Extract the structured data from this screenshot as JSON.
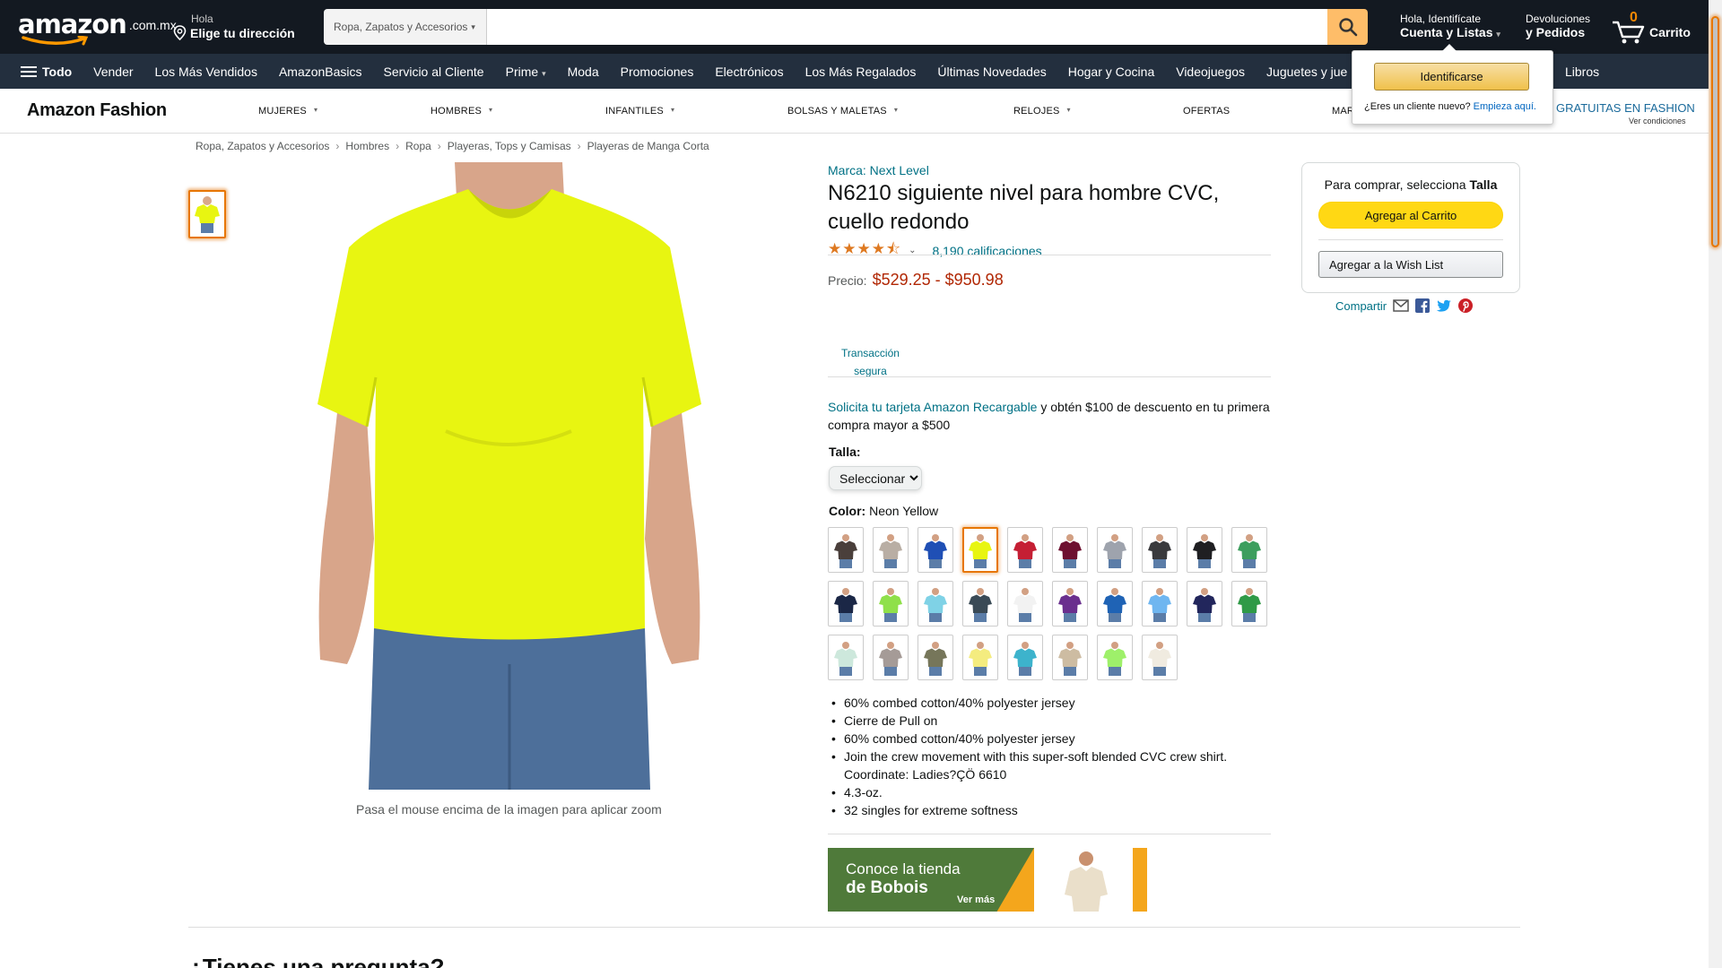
{
  "nav": {
    "logo_word": "amazon",
    "logo_tld": ".com.mx",
    "address_hello": "Hola",
    "address_cta": "Elige tu dirección",
    "search_category": "Ropa, Zapatos y Accesorios",
    "search_value": "",
    "account_line1": "Hola, Identifícate",
    "account_line2": "Cuenta y Listas",
    "returns_line1": "Devoluciones",
    "returns_line2": "y Pedidos",
    "cart_count": "0",
    "cart_label": "Carrito"
  },
  "subnav": {
    "all_label": "Todo",
    "items": [
      "Vender",
      "Los Más Vendidos",
      "AmazonBasics",
      "Servicio al Cliente",
      "Prime",
      "Moda",
      "Promociones",
      "Electrónicos",
      "Los Más Regalados",
      "Últimas Novedades",
      "Hogar y Cocina",
      "Videojuegos",
      "Juguetes y jue",
      "Libros"
    ]
  },
  "fashion": {
    "brand": "Amazon Fashion",
    "items": [
      "MUJERES",
      "HOMBRES",
      "INFANTILES",
      "BOLSAS Y MALETAS",
      "RELOJES",
      "OFERTAS",
      "MAR"
    ],
    "promo": "GRATUITAS EN FASHION",
    "promo_sub": "Ver condiciones"
  },
  "flyout": {
    "signin_label": "Identificarse",
    "new_customer": "¿Eres un cliente nuevo?",
    "start_here": "Empieza aquí."
  },
  "breadcrumb": [
    "Ropa, Zapatos y Accesorios",
    "Hombres",
    "Ropa",
    "Playeras, Tops y Camisas",
    "Playeras de Manga Corta"
  ],
  "product": {
    "brand_link": "Marca: Next Level",
    "title": "N6210 siguiente nivel para hombre CVC, cuello redondo",
    "rating_stars": 4.5,
    "rating_count": "8,190 calificaciones",
    "price_label": "Precio:",
    "price_value": "$529.25 - $950.98",
    "secure_label": "Transacción segura",
    "promo_link": "Solicita tu tarjeta Amazon Recargable",
    "promo_text": " y obtén $100 de descuento en tu primera compra mayor a $500",
    "size_label": "Talla:",
    "size_selected": "Seleccionar",
    "color_label": "Color:",
    "color_value": "Neon Yellow",
    "zoom_hint": "Pasa el mouse encima de la imagen para aplicar zoom",
    "bullets": [
      "60% combed cotton/40% polyester jersey",
      "Cierre de Pull on",
      "60% combed cotton/40% polyester jersey",
      "Join the crew movement with this super-soft blended CVC crew shirt. Coordinate: Ladies?ÇÖ 6610",
      "4.3-oz.",
      "32 singles for extreme softness"
    ],
    "main_color": "#e8f511",
    "swatch_colors": [
      "#4a3f3b",
      "#b9aea4",
      "#1f4fb5",
      "#e8f511",
      "#c51f34",
      "#6e1030",
      "#9ea3ad",
      "#3a3a3d",
      "#1f1f22",
      "#3d9e5e",
      "#1b2746",
      "#8fe04a",
      "#7fd2e6",
      "#3a4a56",
      "#f2f2f2",
      "#6a2f8e",
      "#1f63b5",
      "#6fb6f0",
      "#22265c",
      "#2f9a47",
      "#cde8dc",
      "#a59b97",
      "#76765a",
      "#f4ec7f",
      "#3db3cc",
      "#cdbca2",
      "#9ef06a",
      "#f0ebe0"
    ],
    "selected_swatch": 3
  },
  "banner": {
    "line1": "Conoce la tienda",
    "line2": "de Bobois",
    "cta": "Ver más"
  },
  "question_heading": "¿Tienes una pregunta?",
  "buybox": {
    "label_prefix": "Para comprar, selecciona",
    "label_bold": "Talla",
    "cart_button": "Agregar al Carrito",
    "wish_button": "Agregar a la Wish List",
    "share_label": "Compartir"
  }
}
